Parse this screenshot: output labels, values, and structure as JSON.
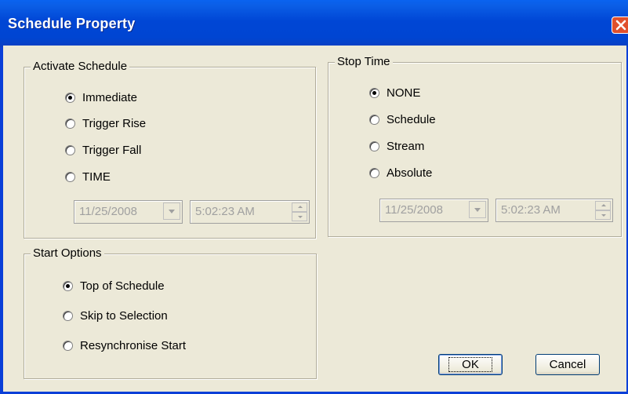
{
  "window": {
    "title": "Schedule Property"
  },
  "activate_schedule": {
    "label": "Activate Schedule",
    "options": [
      "Immediate",
      "Trigger Rise",
      "Trigger Fall",
      "TIME"
    ],
    "selected": "Immediate",
    "date": "11/25/2008",
    "time": "5:02:23 AM"
  },
  "stop_time": {
    "label": "Stop Time",
    "options": [
      "NONE",
      "Schedule",
      "Stream",
      "Absolute"
    ],
    "selected": "NONE",
    "date": "11/25/2008",
    "time": "5:02:23 AM"
  },
  "start_options": {
    "label": "Start Options",
    "options": [
      "Top of Schedule",
      "Skip to Selection",
      "Resynchronise Start"
    ],
    "selected": "Top of Schedule"
  },
  "buttons": {
    "ok": "OK",
    "cancel": "Cancel"
  },
  "icons": {
    "close": "close-icon",
    "dropdown": "chevron-down-icon",
    "spin": "spinner-arrows-icon"
  }
}
